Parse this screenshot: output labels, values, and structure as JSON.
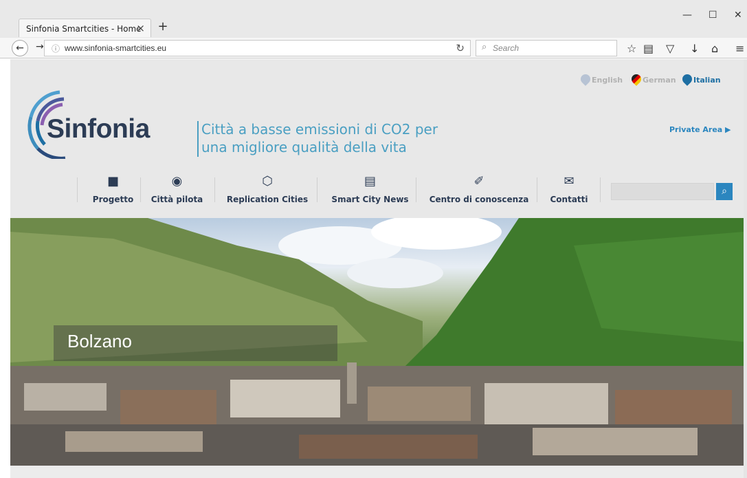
{
  "browser": {
    "tab_title": "Sinfonia Smartcities - Home",
    "tab_close": "×",
    "new_tab": "+",
    "url": "www.sinfonia-smartcities.eu",
    "search_placeholder": "Search",
    "window_controls": [
      "—",
      "☐",
      "✕"
    ],
    "toolbar_icons": [
      "bookmark-star-icon",
      "reading-list-icon",
      "pocket-icon",
      "downloads-icon",
      "home-icon",
      "menu-icon"
    ]
  },
  "header": {
    "logo_text": "Sinfonia",
    "tagline_line1": "Città a basse emissioni di CO2 per",
    "tagline_line2": "una migliore qualità della vita",
    "languages": [
      {
        "label": "English",
        "active": false
      },
      {
        "label": "German",
        "active": false
      },
      {
        "label": "Italian",
        "active": true
      }
    ],
    "private_area": "Private Area ▶"
  },
  "menu": {
    "items": [
      {
        "label": "Progetto",
        "icon": "folder-icon"
      },
      {
        "label": "Città pilota",
        "icon": "map-pin-icon"
      },
      {
        "label": "Replication Cities",
        "icon": "cube-icon"
      },
      {
        "label": "Smart City News",
        "icon": "newspaper-icon"
      },
      {
        "label": "Centro di conoscenza",
        "icon": "book-icon"
      },
      {
        "label": "Contatti",
        "icon": "envelope-icon"
      }
    ],
    "search_value": ""
  },
  "hero": {
    "caption": "Bolzano"
  },
  "colors": {
    "brand_dark": "#2c3c55",
    "brand_blue": "#2b86bf",
    "tagline_blue": "#4a9fc2"
  }
}
